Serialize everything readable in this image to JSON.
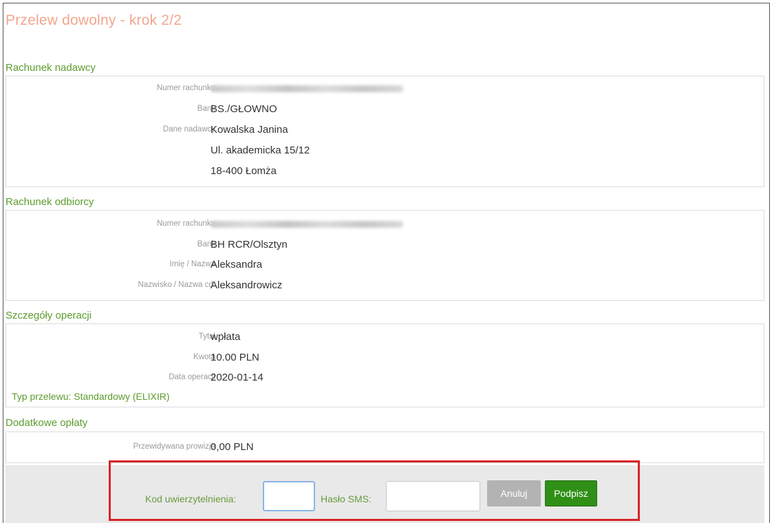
{
  "page": {
    "title": "Przelew dowolny - krok 2/2"
  },
  "sender": {
    "header": "Rachunek nadawcy",
    "account_label": "Numer rachunku",
    "bank_label": "Bank",
    "bank_value": "BS./GŁOWNO",
    "data_label": "Dane nadawcy",
    "name": "Kowalska Janina",
    "street": "Ul. akademicka 15/12",
    "city": "18-400 Łomża"
  },
  "recipient": {
    "header": "Rachunek odbiorcy",
    "account_label": "Numer rachunku",
    "bank_label": "Bank",
    "bank_value": "BH RCR/Olsztyn",
    "first_name_label": "Imię / Nazwa",
    "first_name_value": "Aleksandra",
    "last_name_label": "Nazwisko / Nazwa cd.",
    "last_name_value": "Aleksandrowicz"
  },
  "operation": {
    "header": "Szczegóły operacji",
    "title_label": "Tytuł",
    "title_value": "wpłata",
    "amount_label": "Kwota",
    "amount_value": "10.00 PLN",
    "date_label": "Data operacji",
    "date_value": "2020-01-14",
    "transfer_type": "Typ przelewu: Standardowy (ELIXIR)"
  },
  "fees": {
    "header": "Dodatkowe opłaty",
    "commission_label": "Przewidywana prowizja",
    "commission_value": "0,00 PLN"
  },
  "auth": {
    "code_label": "Kod uwierzytelnienia:",
    "code_value": "",
    "sms_label": "Hasło SMS:",
    "sms_value": "",
    "cancel_label": "Anuluj",
    "sign_label": "Podpisz"
  },
  "colors": {
    "accent": "#5c9c2e",
    "title": "#f2a68e",
    "sign_button": "#2f8f17",
    "highlight": "#d92228"
  }
}
